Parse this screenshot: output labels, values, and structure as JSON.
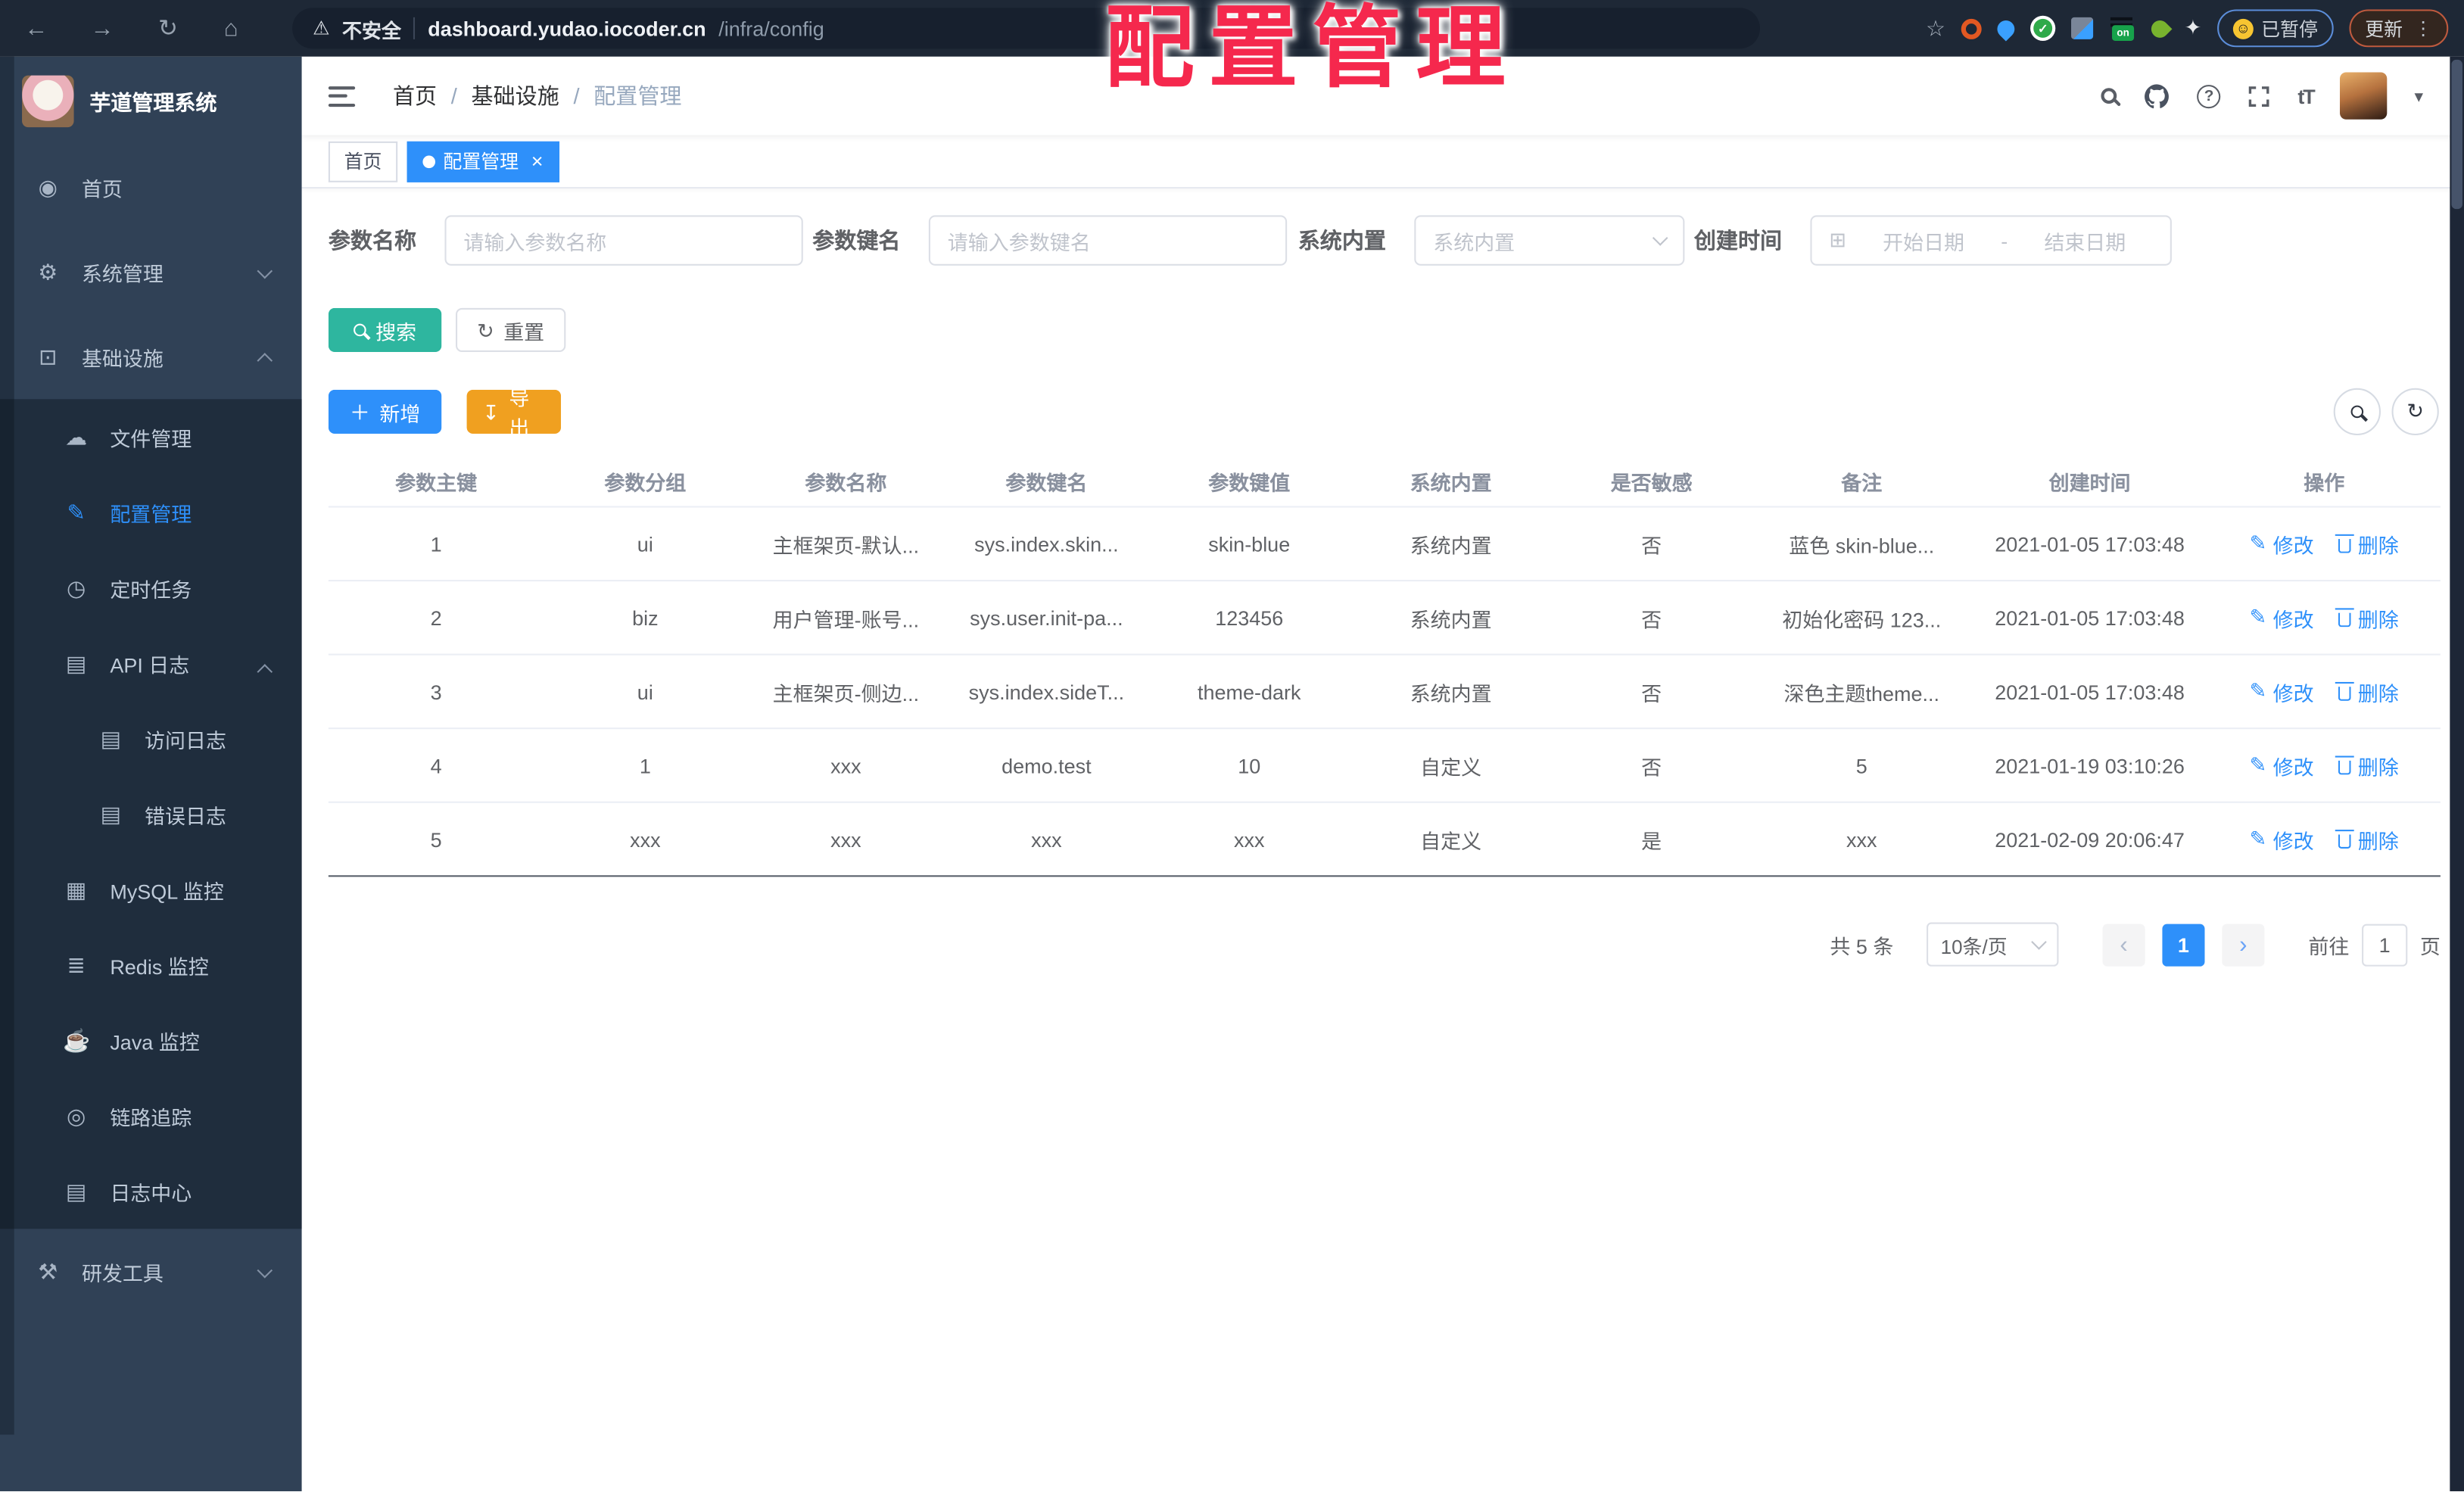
{
  "annotation": {
    "title": "配置管理"
  },
  "icons": {
    "back": "←",
    "forward": "→",
    "reload": "↻",
    "home": "⌂",
    "warning": "⚠",
    "bookmark_star": "☆",
    "overflow_menu": "⋮",
    "smiley": "☺",
    "extension": "✦",
    "check": "✓",
    "on_badge": "on",
    "edit": "✎",
    "refresh": "↻",
    "plus": "＋",
    "download": "↧",
    "calendar": "⊞",
    "caret_down": "▾",
    "close": "×",
    "prev": "‹",
    "next": "›",
    "font_size": "tT"
  },
  "browser": {
    "security_label": "不安全",
    "url_host": "dashboard.yudao.iocoder.cn",
    "url_path": "/infra/config",
    "paused_badge": "已暂停",
    "update_button": "更新"
  },
  "sidebar": {
    "app_title": "芋道管理系统",
    "items": [
      {
        "label": "首页",
        "glyph": "◉"
      },
      {
        "label": "系统管理",
        "glyph": "⚙"
      },
      {
        "label": "基础设施",
        "glyph": "⊡"
      },
      {
        "label": "文件管理",
        "glyph": "☁"
      },
      {
        "label": "配置管理",
        "glyph": "✎"
      },
      {
        "label": "定时任务",
        "glyph": "◷"
      },
      {
        "label": "API 日志",
        "glyph": "▤"
      },
      {
        "label": "访问日志",
        "glyph": "▤"
      },
      {
        "label": "错误日志",
        "glyph": "▤"
      },
      {
        "label": "MySQL 监控",
        "glyph": "▦"
      },
      {
        "label": "Redis 监控",
        "glyph": "≣"
      },
      {
        "label": "Java 监控",
        "glyph": "☕"
      },
      {
        "label": "链路追踪",
        "glyph": "◎"
      },
      {
        "label": "日志中心",
        "glyph": "▤"
      },
      {
        "label": "研发工具",
        "glyph": "⚒"
      }
    ]
  },
  "navbar": {
    "breadcrumb": [
      "首页",
      "基础设施",
      "配置管理"
    ],
    "separator": "/"
  },
  "tabs": {
    "home": "首页",
    "current": "配置管理"
  },
  "filters": {
    "name_label": "参数名称",
    "name_placeholder": "请输入参数名称",
    "key_label": "参数键名",
    "key_placeholder": "请输入参数键名",
    "type_label": "系统内置",
    "type_placeholder": "系统内置",
    "date_label": "创建时间",
    "date_start": "开始日期",
    "date_sep": "-",
    "date_end": "结束日期"
  },
  "toolbar": {
    "search": "搜索",
    "reset": "重置",
    "create": "新增",
    "export": "导出"
  },
  "table": {
    "columns": [
      "参数主键",
      "参数分组",
      "参数名称",
      "参数键名",
      "参数键值",
      "系统内置",
      "是否敏感",
      "备注",
      "创建时间",
      "操作"
    ],
    "actions": {
      "edit": "修改",
      "delete": "删除"
    },
    "rows": [
      {
        "cells": [
          "1",
          "ui",
          "主框架页-默认...",
          "sys.index.skin...",
          "skin-blue",
          "系统内置",
          "否",
          "蓝色 skin-blue...",
          "2021-01-05 17:03:48"
        ]
      },
      {
        "cells": [
          "2",
          "biz",
          "用户管理-账号...",
          "sys.user.init-pa...",
          "123456",
          "系统内置",
          "否",
          "初始化密码 123...",
          "2021-01-05 17:03:48"
        ]
      },
      {
        "cells": [
          "3",
          "ui",
          "主框架页-侧边...",
          "sys.index.sideT...",
          "theme-dark",
          "系统内置",
          "否",
          "深色主题theme...",
          "2021-01-05 17:03:48"
        ]
      },
      {
        "cells": [
          "4",
          "1",
          "xxx",
          "demo.test",
          "10",
          "自定义",
          "否",
          "5",
          "2021-01-19 03:10:26"
        ]
      },
      {
        "cells": [
          "5",
          "xxx",
          "xxx",
          "xxx",
          "xxx",
          "自定义",
          "是",
          "xxx",
          "2021-02-09 20:06:47"
        ]
      }
    ]
  },
  "pagination": {
    "total": "共 5 条",
    "page_size": "10条/页",
    "page": "1",
    "goto_label": "前往",
    "goto_value": "1",
    "page_unit": "页"
  },
  "colors": {
    "accent_blue": "#2e90fa",
    "teal": "#2eb69f",
    "orange": "#f0a020",
    "sidebar_bg": "#304156",
    "submenu_bg": "#1f2d3d",
    "annotation_red": "#f5284d"
  }
}
